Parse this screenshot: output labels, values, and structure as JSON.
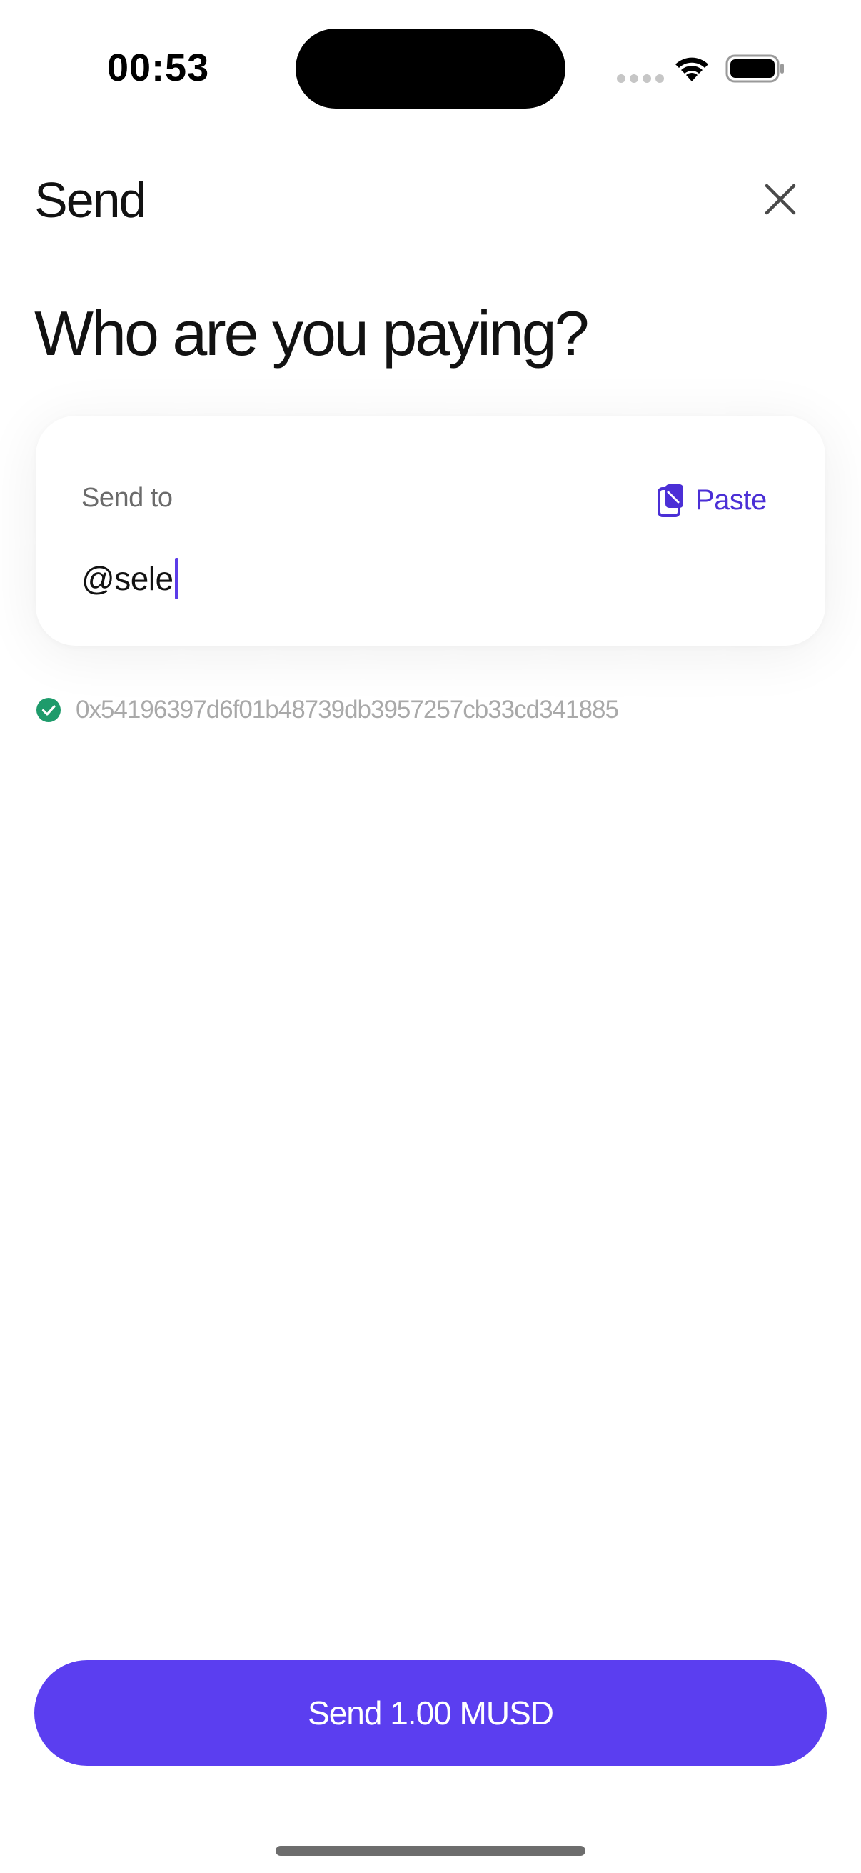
{
  "status_bar": {
    "time": "00:53"
  },
  "header": {
    "title": "Send",
    "close_icon": "close-icon"
  },
  "main": {
    "heading": "Who are you paying?",
    "card": {
      "label": "Send to",
      "paste_label": "Paste",
      "paste_icon": "clipboard-icon",
      "input_value": "@sele"
    },
    "resolved": {
      "icon": "check-circle-icon",
      "address": "0x54196397d6f01b48739db3957257cb33cd341885"
    }
  },
  "footer": {
    "send_button_label": "Send 1.00 MUSD"
  },
  "colors": {
    "accent": "#5b3ef0",
    "paste_text": "#4b2fd6",
    "success": "#1e9b6b",
    "muted_text": "#a9a9a9"
  }
}
